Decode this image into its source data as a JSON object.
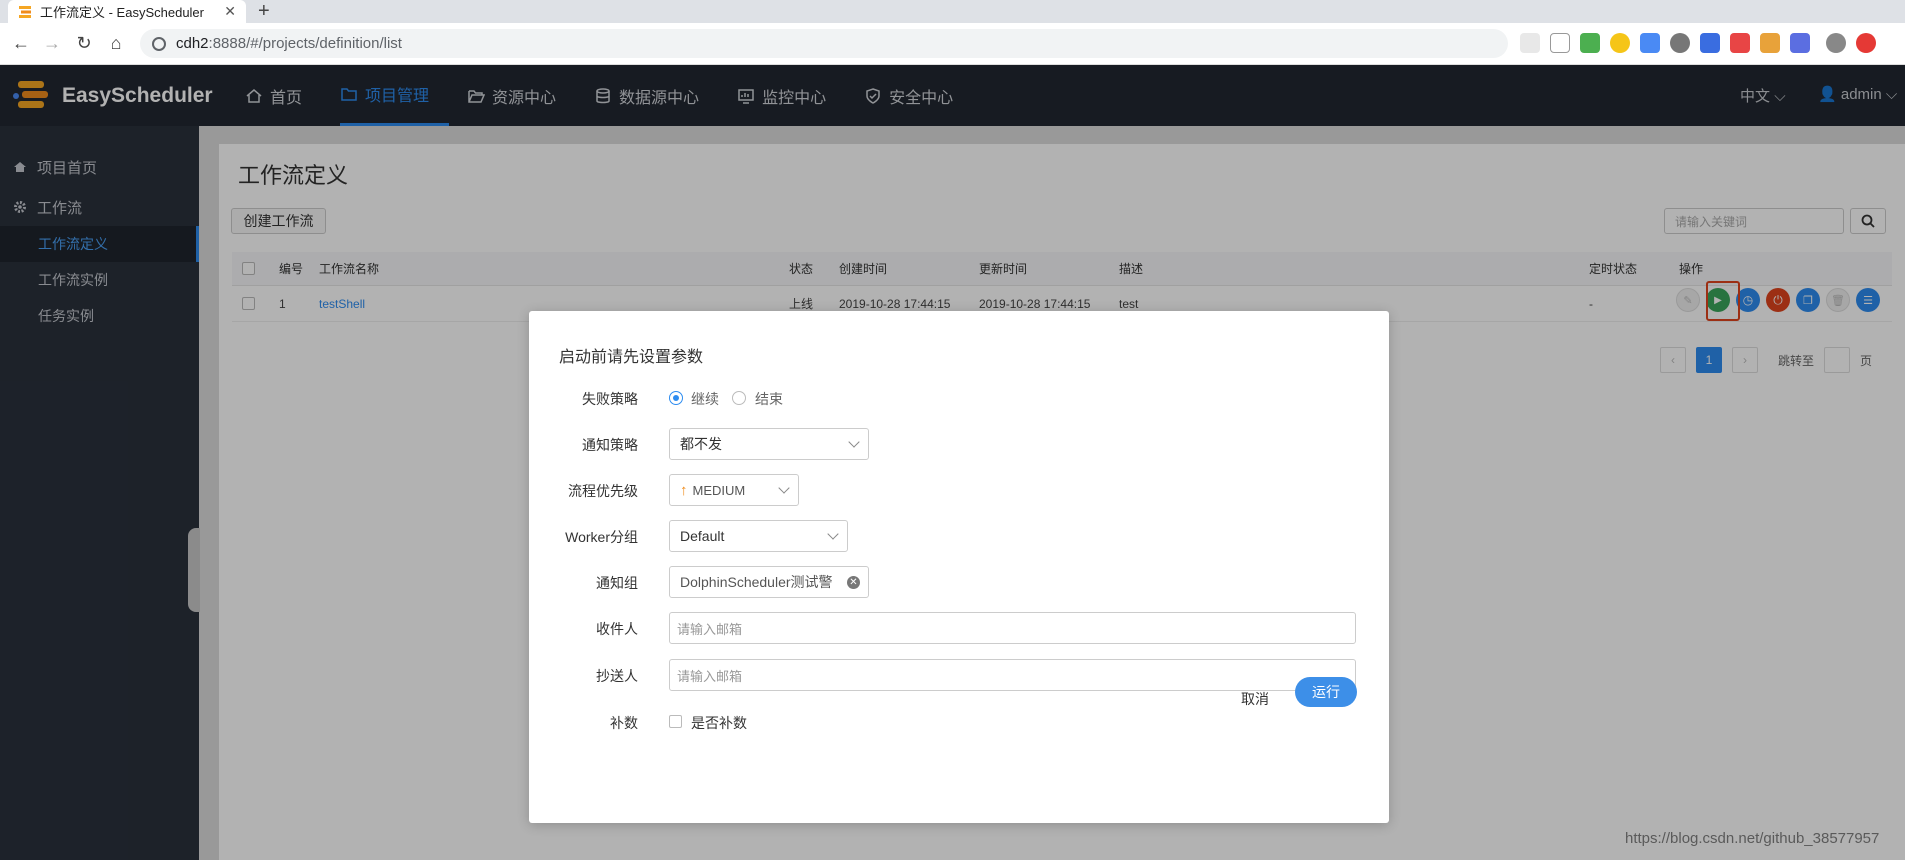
{
  "browser": {
    "tab_title": "工作流定义 - EasyScheduler",
    "new_tab": "+",
    "url_host": "cdh2",
    "url_rest": ":8888/#/projects/definition/list"
  },
  "app": {
    "logo_text": "EasyScheduler",
    "nav": [
      "首页",
      "项目管理",
      "资源中心",
      "数据源中心",
      "监控中心",
      "安全中心"
    ],
    "active_nav": "项目管理",
    "language": "中文",
    "user": "admin"
  },
  "sidebar": {
    "items": [
      {
        "label": "项目首页",
        "icon": "home-icon"
      },
      {
        "label": "工作流",
        "icon": "gear-icon"
      }
    ],
    "sub_items": [
      "工作流定义",
      "工作流实例",
      "任务实例"
    ],
    "active": "工作流定义"
  },
  "page": {
    "title": "工作流定义",
    "create_button": "创建工作流",
    "search_placeholder": "请输入关键词",
    "table": {
      "columns": [
        "编号",
        "工作流名称",
        "状态",
        "创建时间",
        "更新时间",
        "描述",
        "定时状态",
        "操作"
      ],
      "rows": [
        {
          "id": "1",
          "name": "testShell",
          "status": "上线",
          "created": "2019-10-28 17:44:15",
          "updated": "2019-10-28 17:44:15",
          "desc": "test",
          "schedule": "-"
        }
      ]
    },
    "pagination": {
      "current": "1",
      "goto_label": "跳转至",
      "page_label": "页"
    }
  },
  "modal": {
    "title": "启动前请先设置参数",
    "failure_strategy": {
      "label": "失败策略",
      "options": [
        "继续",
        "结束"
      ],
      "selected": "继续"
    },
    "notify_strategy": {
      "label": "通知策略",
      "value": "都不发"
    },
    "priority": {
      "label": "流程优先级",
      "value": "MEDIUM"
    },
    "worker_group": {
      "label": "Worker分组",
      "value": "Default"
    },
    "notify_group": {
      "label": "通知组",
      "value": "DolphinScheduler测试警"
    },
    "receivers": {
      "label": "收件人",
      "placeholder": "请输入邮箱"
    },
    "cc": {
      "label": "抄送人",
      "placeholder": "请输入邮箱"
    },
    "complement": {
      "label": "补数",
      "checkbox_label": "是否补数"
    },
    "cancel": "取消",
    "run": "运行"
  },
  "watermark": "https://blog.csdn.net/github_38577957",
  "colors": {
    "accent": "#2d8cf0",
    "header_bg": "#222832",
    "sidebar_bg": "#2a313c",
    "run_green": "#3aa55b",
    "danger_red": "#e0441e"
  }
}
